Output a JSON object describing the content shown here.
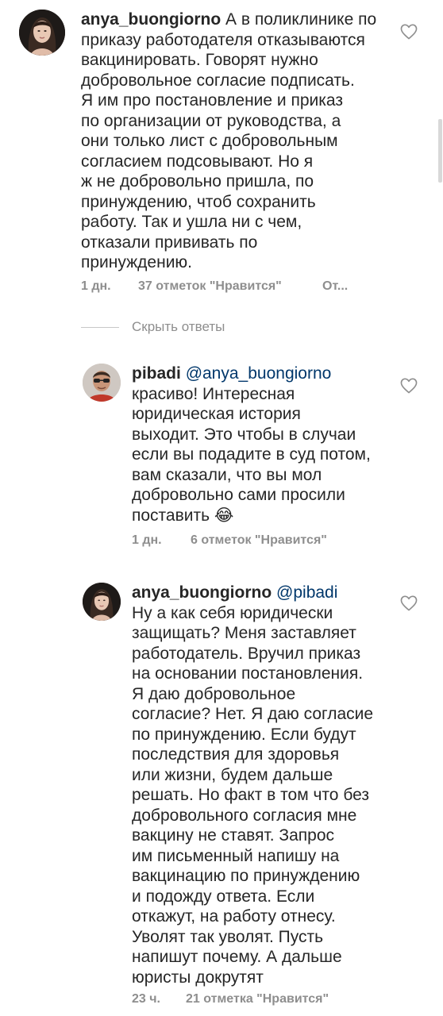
{
  "comments": [
    {
      "username": "anya_buongiorno",
      "mention": "",
      "lines": [
        "А в поликлинике по",
        "приказу работодателя отказываются",
        "вакцинировать. Говорят нужно",
        "добровольное согласие подписать.",
        "Я им про постановление и  приказ",
        "по организации от руководства, а",
        "они только лист с добровольным",
        "согласием подсовывают. Но я",
        "ж не добровольно пришла, по",
        "принуждению, чтоб сохранить",
        "работу. Так и ушла ни с чем,",
        "отказали прививать по",
        "принуждению."
      ],
      "time": "1 дн.",
      "likes": "37 отметок \"Нравится\"",
      "reply": "От...",
      "heart_icon": "heart-outline-icon"
    },
    {
      "username": "pibadi",
      "mention": "@anya_buongiorno",
      "lines": [
        "красиво! Интересная",
        "юридическая история",
        "выходит. Это чтобы в случаи",
        "если вы подадите в суд потом,",
        "вам сказали, что вы мол",
        "добровольно сами просили",
        "поставить"
      ],
      "emoji": "😂",
      "time": "1 дн.",
      "likes": "6 отметок \"Нравится\"",
      "heart_icon": "heart-outline-icon"
    },
    {
      "username": "anya_buongiorno",
      "mention": "@pibadi",
      "lines": [
        "Ну а как себя юридически",
        "защищать? Меня заставляет",
        "работодатель. Вручил приказ",
        "на основании постановления.",
        "Я даю добровольное",
        "согласие? Нет. Я даю согласие",
        "по принуждению. Если будут",
        "последствия для здоровья",
        "или жизни, будем дальше",
        "решать. Но факт в том что без",
        "добровольного согласия мне",
        "вакцину не ставят. Запрос",
        "им письменный напишу на",
        "вакцинацию по принуждению",
        "и подожду ответа. Если",
        "откажут, на работу отнесу.",
        "Уволят так уволят. Пусть",
        "напишут почему. А дальше",
        "юристы докрутят"
      ],
      "time": "23 ч.",
      "likes": "21 отметка \"Нравится\"",
      "heart_icon": "heart-outline-icon"
    }
  ],
  "hide_replies_label": "Скрыть ответы",
  "colors": {
    "text": "#262626",
    "meta": "#8e8e8e",
    "mention": "#00376b",
    "background": "#ffffff"
  }
}
